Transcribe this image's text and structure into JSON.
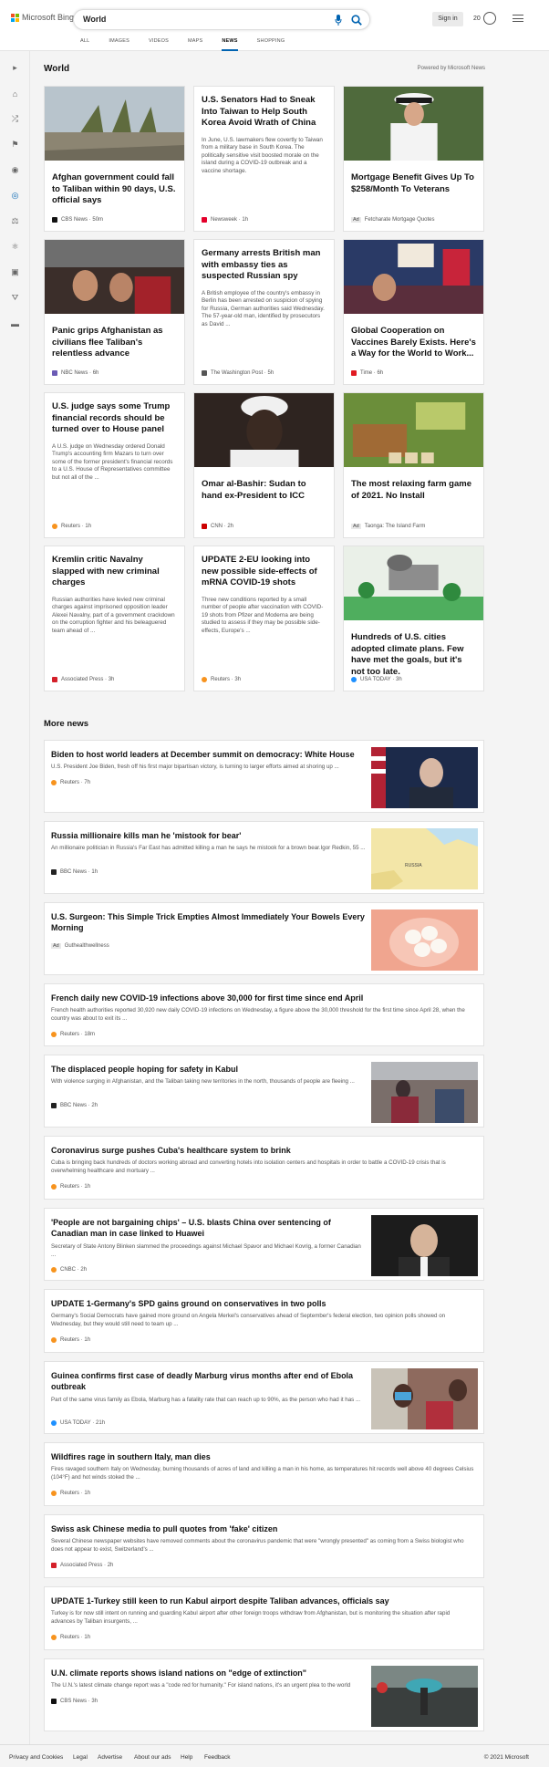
{
  "header": {
    "logo_text": "Microsoft Bing",
    "search_value": "World",
    "signin_label": "Sign in",
    "rewards_count": "20"
  },
  "tabs": [
    {
      "label": "ALL"
    },
    {
      "label": "IMAGES"
    },
    {
      "label": "VIDEOS"
    },
    {
      "label": "MAPS"
    },
    {
      "label": "NEWS",
      "active": true
    },
    {
      "label": "SHOPPING"
    }
  ],
  "sidebar_icons": [
    "expand-icon",
    "home-icon",
    "shuffle-icon",
    "flag-icon",
    "location-icon",
    "world-icon",
    "scales-icon",
    "science-icon",
    "video-icon",
    "bank-icon",
    "money-icon"
  ],
  "main": {
    "section_title": "World",
    "powered_by": "Powered by Microsoft News",
    "more_title": "More news"
  },
  "cards": [
    {
      "title": "Afghan government could fall to Taliban within 90 days, U.S. official says",
      "source": "CBS News",
      "time": "50m",
      "has_image": true,
      "source_color": "#111111"
    },
    {
      "title": "U.S. Senators Had to Sneak Into Taiwan to Help South Korea Avoid Wrath of China",
      "abstract": "In June, U.S. lawmakers flew covertly to Taiwan from a military base in South Korea. The politically sensitive visit boosted morale on the island during a COVID-19 outbreak and a vaccine shortage.",
      "source": "Newsweek",
      "time": "1h",
      "has_image": false,
      "source_color": "#e4002b"
    },
    {
      "title": "Mortgage Benefit Gives Up To $258/Month To Veterans",
      "source": "Fetcharate Mortgage Quotes",
      "ad_label": "Ad",
      "has_image": true
    },
    {
      "title": "Panic grips Afghanistan as civilians flee Taliban's relentless advance",
      "source": "NBC News",
      "time": "6h",
      "has_image": true,
      "source_color": "#6b5bb5"
    },
    {
      "title": "Germany arrests British man with embassy ties as suspected Russian spy",
      "abstract": "A British employee of the country's embassy in Berlin has been arrested on suspicion of spying for Russia, German authorities said Wednesday. The 57-year-old man, identified by prosecutors as David ...",
      "source": "The Washington Post",
      "time": "5h",
      "has_image": false,
      "source_color": "#555555"
    },
    {
      "title": "Global Cooperation on Vaccines Barely Exists. Here's a Way for the World to Work...",
      "source": "Time",
      "time": "6h",
      "has_image": true,
      "source_color": "#e01a22"
    },
    {
      "title": "U.S. judge says some Trump financial records should be turned over to House panel",
      "abstract": "A U.S. judge on Wednesday ordered Donald Trump's accounting firm Mazars to turn over some of the former president's financial records to a U.S. House of Representatives committee but not all of the ...",
      "source": "Reuters",
      "time": "1h",
      "has_image": false,
      "source_color": "#f7931e"
    },
    {
      "title": "Omar al-Bashir: Sudan to hand ex-President to ICC",
      "source": "CNN",
      "time": "2h",
      "has_image": true,
      "source_color": "#cc0000"
    },
    {
      "title": "The most relaxing farm game of 2021. No Install",
      "source": "Taonga: The Island Farm",
      "ad_label": "Ad",
      "has_image": true
    },
    {
      "title": "Kremlin critic Navalny slapped with new criminal charges",
      "abstract": "Russian authorities have levied new criminal charges against imprisoned opposition leader Alexei Navalny, part of a government crackdown on the corruption fighter and his beleaguered team ahead of ...",
      "source": "Associated Press",
      "time": "3h",
      "has_image": false,
      "source_color": "#d4202a"
    },
    {
      "title": "UPDATE 2-EU looking into new possible side-effects of mRNA COVID-19 shots",
      "abstract": "Three new conditions reported by a small number of people after vaccination with COVID-19 shots from Pfizer and Moderna are being studied to assess if they may be possible side-effects, Europe's ...",
      "source": "Reuters",
      "time": "3h",
      "has_image": false,
      "source_color": "#f7931e"
    },
    {
      "title": "Hundreds of U.S. cities adopted climate plans. Few have met the goals, but it's not too late.",
      "source": "USA TODAY",
      "time": "3h",
      "has_image": true,
      "source_color": "#1e90ff"
    }
  ],
  "more_news": [
    {
      "title": "Biden to host world leaders at December summit on democracy: White House",
      "abstract": "U.S. President Joe Biden, fresh off his first major bipartisan victory, is turning to larger efforts aimed at shoring up ...",
      "source": "Reuters",
      "time": "7h",
      "has_image": true,
      "source_color": "#f7931e"
    },
    {
      "title": "Russia millionaire kills man he 'mistook for bear'",
      "abstract": "An millionaire politician in Russia's Far East has admitted killing a man he says he mistook for a brown bear.Igor Redkin, 55 ...",
      "source": "BBC News",
      "time": "1h",
      "has_image": true,
      "map_label": "RUSSIA",
      "source_color": "#222222"
    },
    {
      "title": "U.S. Surgeon: This Simple Trick Empties Almost Immediately Your Bowels Every Morning",
      "source": "Guthealthwellness",
      "ad_label": "Ad",
      "has_image": true
    },
    {
      "title": "French daily new COVID-19 infections above 30,000 for first time since end April",
      "abstract": "French health authorities reported 30,920 new daily COVID-19 infections on Wednesday, a figure above the 30,000 threshold for the first time since April 28, when the country was about to exit its ...",
      "source": "Reuters",
      "time": "18m",
      "has_image": false,
      "source_color": "#f7931e"
    },
    {
      "title": "The displaced people hoping for safety in Kabul",
      "abstract": "With violence surging in Afghanistan, and the Taliban taking new territories in the north, thousands of people are fleeing ...",
      "source": "BBC News",
      "time": "2h",
      "has_image": true,
      "source_color": "#222222"
    },
    {
      "title": "Coronavirus surge pushes Cuba's healthcare system to brink",
      "abstract": "Cuba is bringing back hundreds of doctors working abroad and converting hotels into isolation centers and hospitals in order to battle a COVID-19 crisis that is overwhelming healthcare and mortuary ...",
      "source": "Reuters",
      "time": "1h",
      "has_image": false,
      "source_color": "#f7931e"
    },
    {
      "title": "'People are not bargaining chips' – U.S. blasts China over sentencing of Canadian man in case linked to Huawei",
      "abstract": "Secretary of State Antony Blinken slammed the proceedings against Michael Spavor and Michael Kovrig, a former Canadian ...",
      "source": "CNBC",
      "time": "2h",
      "has_image": true,
      "source_color": "#f7941d"
    },
    {
      "title": "UPDATE 1-Germany's SPD gains ground on conservatives in two polls",
      "abstract": "Germany's Social Democrats have gained more ground on Angela Merkel's conservatives ahead of September's federal election, two opinion polls showed on Wednesday, but they would still need to team up ...",
      "source": "Reuters",
      "time": "1h",
      "has_image": false,
      "source_color": "#f7931e"
    },
    {
      "title": "Guinea confirms first case of deadly Marburg virus months after end of Ebola outbreak",
      "abstract": "Part of the same virus family as Ebola, Marburg has a fatality rate that can reach up to 90%, as the person who had it has ...",
      "source": "USA TODAY",
      "time": "21h",
      "has_image": true,
      "source_color": "#1e90ff"
    },
    {
      "title": "Wildfires rage in southern Italy, man dies",
      "abstract": "Fires ravaged southern Italy on Wednesday, burning thousands of acres of land and killing a man in his home, as temperatures hit records well above 40 degrees Celsius (104°F) and hot winds stoked the ...",
      "source": "Reuters",
      "time": "1h",
      "has_image": false,
      "source_color": "#f7931e"
    },
    {
      "title": "Swiss ask Chinese media to pull quotes from 'fake' citizen",
      "abstract": "Several Chinese newspaper websites have removed comments about the coronavirus pandemic that were \"wrongly presented\" as coming from a Swiss biologist who does not appear to exist, Switzerland's ...",
      "source": "Associated Press",
      "time": "2h",
      "has_image": false,
      "source_color": "#d4202a"
    },
    {
      "title": "UPDATE 1-Turkey still keen to run Kabul airport despite Taliban advances, officials say",
      "abstract": "Turkey is for now still intent on running and guarding Kabul airport after other foreign troops withdraw from Afghanistan, but is monitoring the situation after rapid advances by Taliban insurgents, ...",
      "source": "Reuters",
      "time": "1h",
      "has_image": false,
      "source_color": "#f7931e"
    },
    {
      "title": "U.N. climate reports shows island nations on \"edge of extinction\"",
      "abstract": "The U.N.'s latest climate change report was a \"code red for humanity.\" For island nations, it's an urgent plea to the world",
      "source": "CBS News",
      "time": "3h",
      "has_image": true,
      "source_color": "#111111"
    }
  ],
  "footer": {
    "links": [
      "Privacy and Cookies",
      "Legal",
      "Advertise",
      "About our ads",
      "Help",
      "Feedback"
    ],
    "copyright": "© 2021 Microsoft"
  },
  "colors": {
    "accent": "#0063b1",
    "background": "#f4f4f4"
  }
}
